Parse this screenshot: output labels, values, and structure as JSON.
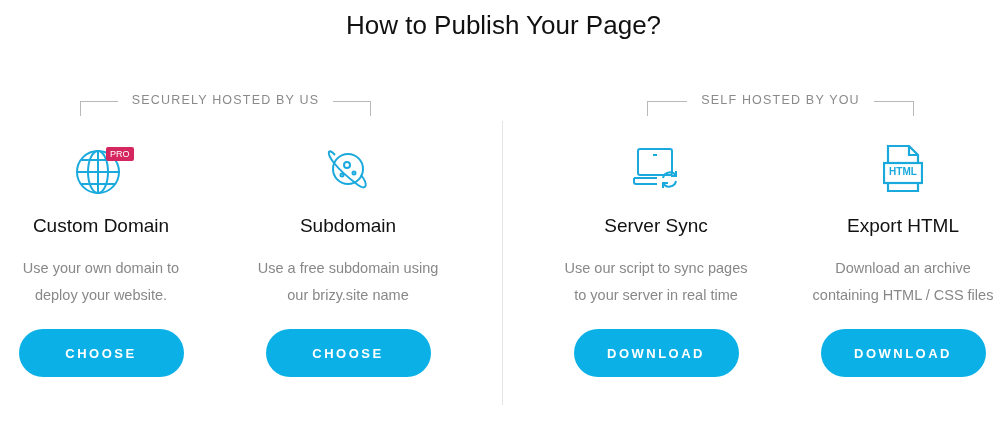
{
  "title": "How to Publish Your Page?",
  "groups": [
    {
      "label": "SECURELY HOSTED BY US",
      "options": [
        {
          "kind": "globe",
          "badge": "PRO",
          "name": "Custom Domain",
          "description": "Use your own domain to deploy your website.",
          "button": "CHOOSE"
        },
        {
          "kind": "planet",
          "name": "Subdomain",
          "description": "Use a free subdomain using our brizy.site name",
          "button": "CHOOSE"
        }
      ]
    },
    {
      "label": "SELF HOSTED BY YOU",
      "options": [
        {
          "kind": "laptop-sync",
          "name": "Server Sync",
          "description": "Use our script to sync pages to your server in real time",
          "button": "DOWNLOAD"
        },
        {
          "kind": "html-file",
          "icon_text": "HTML",
          "name": "Export HTML",
          "description": "Download an archive containing HTML / CSS files",
          "button": "DOWNLOAD"
        }
      ]
    }
  ]
}
